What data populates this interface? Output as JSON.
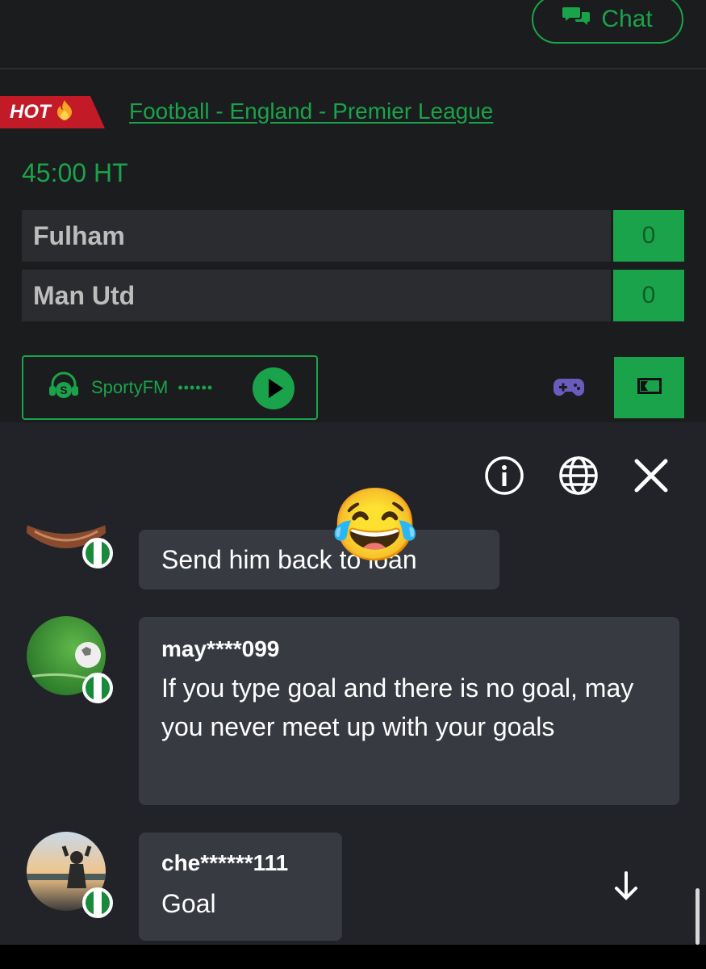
{
  "header": {
    "chat_label": "Chat"
  },
  "match": {
    "hot_label": "HOT",
    "league": "Football - England - Premier League",
    "time": "45:00 HT",
    "teams": [
      {
        "name": "Fulham",
        "score": "0"
      },
      {
        "name": "Man Utd",
        "score": "0"
      }
    ]
  },
  "radio": {
    "label": "SportyFM",
    "dots": "••••••"
  },
  "chat": {
    "messages": [
      {
        "username": "",
        "text_before": "Send him back to loan",
        "emoji": "😂"
      },
      {
        "username": "may****099",
        "text": "If you type goal and there is no goal, may you never meet up with your goals"
      },
      {
        "username": "che******111",
        "text": "Goal"
      }
    ]
  },
  "colors": {
    "accent": "#1aa34a",
    "hot": "#c21a26",
    "panel": "#212328",
    "bubble": "#383a42"
  }
}
